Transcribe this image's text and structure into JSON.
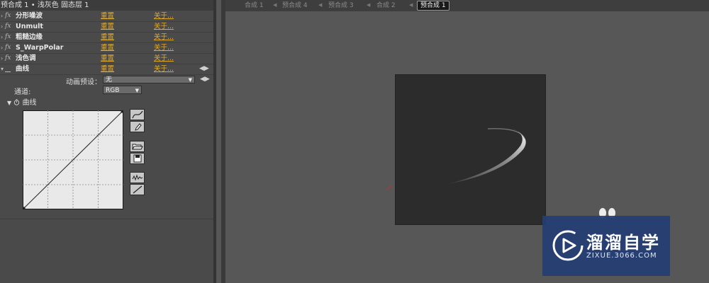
{
  "effect_controls": {
    "title": "预合成 1 • 浅灰色 固态层 1",
    "effects": [
      {
        "name": "分形噪波",
        "reset": "重置",
        "about": "关于..."
      },
      {
        "name": "Unmult",
        "reset": "重置",
        "about": "关于..."
      },
      {
        "name": "粗糙边缘",
        "reset": "重置",
        "about": "关于..."
      },
      {
        "name": "S_WarpPolar",
        "reset": "重置",
        "about": "关于..."
      },
      {
        "name": "浅色调",
        "reset": "重置",
        "about": "关于..."
      },
      {
        "name": "曲线",
        "reset": "重置",
        "about": "关于..."
      }
    ],
    "fx_glyph": "fx",
    "preset_label": "动画预设：",
    "preset_value": "无",
    "channel_label": "通道:",
    "channel_value": "RGB",
    "curve_label": "曲线"
  },
  "composition_tabs": [
    "合成 1",
    "预合成 4",
    "预合成 3",
    "合成 2",
    "预合成 1"
  ],
  "active_tab": "预合成 1",
  "watermark": {
    "title": "溜溜自学",
    "url": "ZIXUE.3066.COM"
  },
  "icons": [
    "twirl-open-icon",
    "curve-tool-icon",
    "pencil-icon",
    "open-folder-icon",
    "save-icon",
    "smooth-icon",
    "linear-icon",
    "stopwatch-icon",
    "play-logo-icon"
  ],
  "colors": {
    "link": "#e1a928",
    "panel": "#4a4a4a",
    "viewer": "#575757",
    "canvas": "#2c2c2c",
    "watermark": "#233e73"
  }
}
